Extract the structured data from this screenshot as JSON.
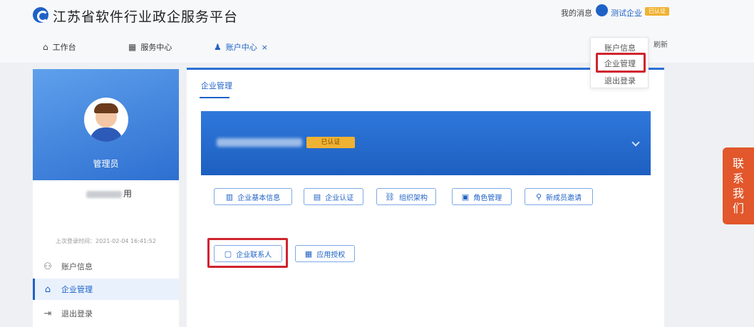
{
  "header": {
    "title": "江苏省软件行业政企服务平台",
    "my_messages": "我的消息",
    "enterprise_name": "测试企业",
    "enterprise_badge": "已认证"
  },
  "nav": {
    "workbench": "工作台",
    "service_center": "服务中心",
    "account_center": "账户中心",
    "close": "×",
    "refresh": "刷新"
  },
  "dropdown": [
    "账户信息",
    "企业管理",
    "退出登录"
  ],
  "profile": {
    "role": "管理员",
    "name_suffix": "用",
    "last_login": "上次登录时间：2021-02-04 16:41:52"
  },
  "sidebar": {
    "items": [
      {
        "label": "账户信息",
        "icon": "user-icon"
      },
      {
        "label": "企业管理",
        "icon": "bank-icon"
      },
      {
        "label": "退出登录",
        "icon": "logout-icon"
      }
    ]
  },
  "main": {
    "tab": "企业管理",
    "card_badge": "已认证",
    "buttons": [
      {
        "label": "企业基本信息",
        "icon": "building-icon"
      },
      {
        "label": "企业认证",
        "icon": "id-card-icon"
      },
      {
        "label": "组织架构",
        "icon": "org-icon"
      },
      {
        "label": "角色管理",
        "icon": "role-icon"
      },
      {
        "label": "新成员邀请",
        "icon": "user-add-icon"
      },
      {
        "label": "企业联系人",
        "icon": "contact-icon"
      },
      {
        "label": "应用授权",
        "icon": "app-icon"
      }
    ]
  },
  "contact_us": [
    "联",
    "系",
    "我",
    "们"
  ],
  "colors": {
    "primary": "#1f62c6",
    "highlight": "#d0242f",
    "contact": "#e2572b",
    "badge": "#f0b233"
  }
}
